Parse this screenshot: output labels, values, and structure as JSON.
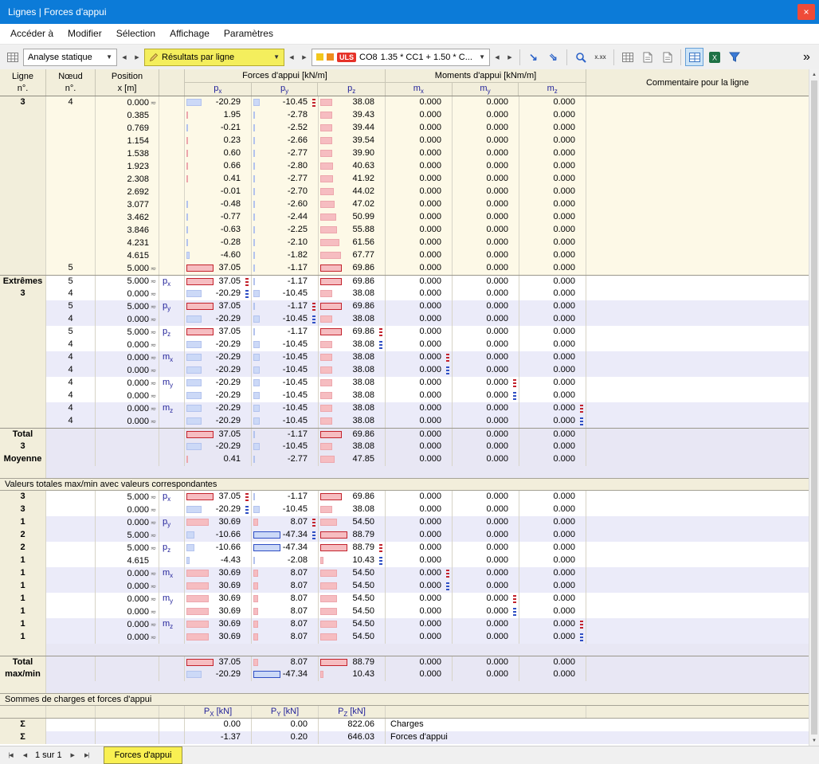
{
  "window": {
    "title": "Lignes | Forces d'appui"
  },
  "menu": [
    "Accéder à",
    "Modifier",
    "Sélection",
    "Affichage",
    "Paramètres"
  ],
  "toolbar": {
    "analysis_label": "Analyse statique",
    "results_label": "Résultats par ligne",
    "uls_badge": "ULS",
    "combo_name": "CO8",
    "combo_formula": "1.35 * CC1 + 1.50 * C...",
    "decimal_icon_label": "x.xx"
  },
  "icons": {
    "chevron_down": "▼",
    "arrow_left": "◀",
    "arrow_right": "▶",
    "result_arrow": "↘",
    "result_arrow2": "⇘",
    "overflow": "»",
    "close": "×",
    "scroll_up": "▲",
    "scroll_down": "▼",
    "pos_symbol": "≂",
    "nav_first": "|◀",
    "nav_prev": "◀",
    "nav_next": "▶",
    "nav_last": "▶|"
  },
  "table": {
    "bar_scales": [
      37.05,
      47.34,
      88.79,
      0,
      0,
      0
    ],
    "header": {
      "ligne": [
        "Ligne",
        "n°."
      ],
      "noeud": [
        "Nœud",
        "n°."
      ],
      "position": [
        "Position",
        "x [m]"
      ],
      "forces": "Forces d'appui [kN/m]",
      "moments": "Moments d'appui [kNm/m]",
      "comment": "Commentaire pour la ligne",
      "subs": [
        "px",
        "py",
        "pz",
        "mx",
        "my",
        "mz"
      ]
    },
    "sections": [
      {
        "type": "rows",
        "bg": "cream",
        "rows": [
          {
            "lg": "3",
            "nd": "4",
            "ps": "0.000",
            "sy": 1,
            "f": [
              "-20.29",
              "-10.45",
              "38.08"
            ],
            "mk": {
              "1": "r"
            }
          },
          {
            "ps": "0.385",
            "f": [
              "1.95",
              "-2.78",
              "39.43"
            ]
          },
          {
            "ps": "0.769",
            "f": [
              "-0.21",
              "-2.52",
              "39.44"
            ]
          },
          {
            "ps": "1.154",
            "f": [
              "0.23",
              "-2.66",
              "39.54"
            ]
          },
          {
            "ps": "1.538",
            "f": [
              "0.60",
              "-2.77",
              "39.90"
            ]
          },
          {
            "ps": "1.923",
            "f": [
              "0.66",
              "-2.80",
              "40.63"
            ]
          },
          {
            "ps": "2.308",
            "f": [
              "0.41",
              "-2.77",
              "41.92"
            ]
          },
          {
            "ps": "2.692",
            "f": [
              "-0.01",
              "-2.70",
              "44.02"
            ]
          },
          {
            "ps": "3.077",
            "f": [
              "-0.48",
              "-2.60",
              "47.02"
            ]
          },
          {
            "ps": "3.462",
            "f": [
              "-0.77",
              "-2.44",
              "50.99"
            ]
          },
          {
            "ps": "3.846",
            "f": [
              "-0.63",
              "-2.25",
              "55.88"
            ]
          },
          {
            "ps": "4.231",
            "f": [
              "-0.28",
              "-2.10",
              "61.56"
            ]
          },
          {
            "ps": "4.615",
            "f": [
              "-4.60",
              "-1.82",
              "67.77"
            ]
          },
          {
            "nd": "5",
            "ps": "5.000",
            "sy": 1,
            "f": [
              "37.05",
              "-1.17",
              "69.86"
            ],
            "hl": [
              0,
              2
            ]
          }
        ]
      },
      {
        "type": "rows",
        "rows": [
          {
            "lg": "Extrêmes",
            "nd": "5",
            "ps": "5.000",
            "sy": 1,
            "lb": "px",
            "f": [
              "37.05",
              "-1.17",
              "69.86"
            ],
            "hl": [
              0,
              2
            ],
            "mk": {
              "0": "r"
            },
            "bg": "white",
            "bt": 1
          },
          {
            "lg": "3",
            "nd": "4",
            "ps": "0.000",
            "sy": 1,
            "f": [
              "-20.29",
              "-10.45",
              "38.08"
            ],
            "mk": {
              "0": "b"
            },
            "bg": "white"
          },
          {
            "nd": "5",
            "ps": "5.000",
            "sy": 1,
            "lb": "py",
            "f": [
              "37.05",
              "-1.17",
              "69.86"
            ],
            "hl": [
              0,
              2
            ],
            "mk": {
              "1": "r"
            },
            "bg": "lav"
          },
          {
            "nd": "4",
            "ps": "0.000",
            "sy": 1,
            "f": [
              "-20.29",
              "-10.45",
              "38.08"
            ],
            "mk": {
              "1": "b"
            },
            "bg": "lav"
          },
          {
            "nd": "5",
            "ps": "5.000",
            "sy": 1,
            "lb": "pz",
            "f": [
              "37.05",
              "-1.17",
              "69.86"
            ],
            "hl": [
              0,
              2
            ],
            "mk": {
              "2": "r"
            },
            "bg": "white"
          },
          {
            "nd": "4",
            "ps": "0.000",
            "sy": 1,
            "f": [
              "-20.29",
              "-10.45",
              "38.08"
            ],
            "mk": {
              "2": "b"
            },
            "bg": "white"
          },
          {
            "nd": "4",
            "ps": "0.000",
            "sy": 1,
            "lb": "mx",
            "f": [
              "-20.29",
              "-10.45",
              "38.08"
            ],
            "mk": {
              "3": "r"
            },
            "bg": "lav"
          },
          {
            "nd": "4",
            "ps": "0.000",
            "sy": 1,
            "f": [
              "-20.29",
              "-10.45",
              "38.08"
            ],
            "mk": {
              "3": "b"
            },
            "bg": "lav"
          },
          {
            "nd": "4",
            "ps": "0.000",
            "sy": 1,
            "lb": "my",
            "f": [
              "-20.29",
              "-10.45",
              "38.08"
            ],
            "mk": {
              "4": "r"
            },
            "bg": "white"
          },
          {
            "nd": "4",
            "ps": "0.000",
            "sy": 1,
            "f": [
              "-20.29",
              "-10.45",
              "38.08"
            ],
            "mk": {
              "4": "b"
            },
            "bg": "white"
          },
          {
            "nd": "4",
            "ps": "0.000",
            "sy": 1,
            "lb": "mz",
            "f": [
              "-20.29",
              "-10.45",
              "38.08"
            ],
            "mk": {
              "5": "r"
            },
            "bg": "lav"
          },
          {
            "nd": "4",
            "ps": "0.000",
            "sy": 1,
            "f": [
              "-20.29",
              "-10.45",
              "38.08"
            ],
            "mk": {
              "5": "b"
            },
            "bg": "lav"
          }
        ]
      },
      {
        "type": "rows",
        "rows": [
          {
            "lg": "Total",
            "f": [
              "37.05",
              "-1.17",
              "69.86"
            ],
            "hl": [
              0,
              2
            ],
            "bg": "total",
            "bt": 1
          },
          {
            "lg": "3",
            "f": [
              "-20.29",
              "-10.45",
              "38.08"
            ],
            "bg": "total"
          },
          {
            "lg": "Moyenne",
            "f": [
              "0.41",
              "-2.77",
              "47.85"
            ],
            "bg": "total"
          }
        ]
      },
      {
        "type": "sep"
      },
      {
        "type": "band",
        "label": "Valeurs totales max/min avec valeurs correspondantes"
      },
      {
        "type": "rows",
        "rows": [
          {
            "lg": "3",
            "ps": "5.000",
            "sy": 1,
            "lb": "px",
            "f": [
              "37.05",
              "-1.17",
              "69.86"
            ],
            "hl": [
              0,
              2
            ],
            "mk": {
              "0": "r"
            },
            "bg": "white"
          },
          {
            "lg": "3",
            "ps": "0.000",
            "sy": 1,
            "f": [
              "-20.29",
              "-10.45",
              "38.08"
            ],
            "mk": {
              "0": "b"
            },
            "bg": "white"
          },
          {
            "lg": "1",
            "ps": "0.000",
            "sy": 1,
            "lb": "py",
            "f": [
              "30.69",
              "8.07",
              "54.50"
            ],
            "mk": {
              "1": "r"
            },
            "bg": "lav"
          },
          {
            "lg": "2",
            "ps": "5.000",
            "sy": 1,
            "f": [
              "-10.66",
              "-47.34",
              "88.79"
            ],
            "hl": [
              1,
              2
            ],
            "mk": {
              "1": "b"
            },
            "bg": "lav"
          },
          {
            "lg": "2",
            "ps": "5.000",
            "sy": 1,
            "lb": "pz",
            "f": [
              "-10.66",
              "-47.34",
              "88.79"
            ],
            "hl": [
              1,
              2
            ],
            "mk": {
              "2": "r"
            },
            "bg": "white"
          },
          {
            "lg": "1",
            "ps": "4.615",
            "f": [
              "-4.43",
              "-2.08",
              "10.43"
            ],
            "mk": {
              "2": "b"
            },
            "bg": "white"
          },
          {
            "lg": "1",
            "ps": "0.000",
            "sy": 1,
            "lb": "mx",
            "f": [
              "30.69",
              "8.07",
              "54.50"
            ],
            "mk": {
              "3": "r"
            },
            "bg": "lav"
          },
          {
            "lg": "1",
            "ps": "0.000",
            "sy": 1,
            "f": [
              "30.69",
              "8.07",
              "54.50"
            ],
            "mk": {
              "3": "b"
            },
            "bg": "lav"
          },
          {
            "lg": "1",
            "ps": "0.000",
            "sy": 1,
            "lb": "my",
            "f": [
              "30.69",
              "8.07",
              "54.50"
            ],
            "mk": {
              "4": "r"
            },
            "bg": "white"
          },
          {
            "lg": "1",
            "ps": "0.000",
            "sy": 1,
            "f": [
              "30.69",
              "8.07",
              "54.50"
            ],
            "mk": {
              "4": "b"
            },
            "bg": "white"
          },
          {
            "lg": "1",
            "ps": "0.000",
            "sy": 1,
            "lb": "mz",
            "f": [
              "30.69",
              "8.07",
              "54.50"
            ],
            "mk": {
              "5": "r"
            },
            "bg": "lav"
          },
          {
            "lg": "1",
            "ps": "0.000",
            "sy": 1,
            "f": [
              "30.69",
              "8.07",
              "54.50"
            ],
            "mk": {
              "5": "b"
            },
            "bg": "lav"
          }
        ]
      },
      {
        "type": "sep"
      },
      {
        "type": "rows",
        "rows": [
          {
            "lg": "Total",
            "f": [
              "37.05",
              "8.07",
              "88.79"
            ],
            "hl": [
              0,
              2
            ],
            "bg": "total",
            "bt": 1
          },
          {
            "lg": "max/min",
            "f": [
              "-20.29",
              "-47.34",
              "10.43"
            ],
            "hl": [
              1
            ],
            "bg": "total"
          }
        ]
      },
      {
        "type": "sep"
      },
      {
        "type": "band",
        "label": "Sommes de charges et forces d'appui"
      },
      {
        "type": "sumhead",
        "labels": [
          "PX [kN]",
          "PY [kN]",
          "PZ [kN]"
        ]
      },
      {
        "type": "rows",
        "rows": [
          {
            "lg": "Σ",
            "s": [
              "0.00",
              "0.00",
              "822.06"
            ],
            "note": "Charges",
            "bg": "white"
          },
          {
            "lg": "Σ",
            "s": [
              "-1.37",
              "0.20",
              "646.03"
            ],
            "note": "Forces d'appui",
            "bg": "lav"
          }
        ]
      }
    ]
  },
  "footer": {
    "pager": "1 sur 1",
    "tab": "Forces d'appui"
  },
  "colors": {
    "titlebar_blue": "#0c7bd8",
    "close_red": "#ef4b38",
    "header_beige": "#f2eedb",
    "row_cream": "#fdf9e7",
    "row_lavender": "#ebebf9",
    "row_total": "#e8e7f4",
    "label_navy": "#22229a",
    "grid_line": "#d7d4c7",
    "bar_positive": "#f6bdc1",
    "bar_negative": "#ccd9f7",
    "max_red": "#c3222c",
    "min_blue": "#2f4fc4",
    "accent_yellow": "#f4ee5d",
    "tab_yellow": "#f9f052",
    "uls_red": "#e63229"
  }
}
